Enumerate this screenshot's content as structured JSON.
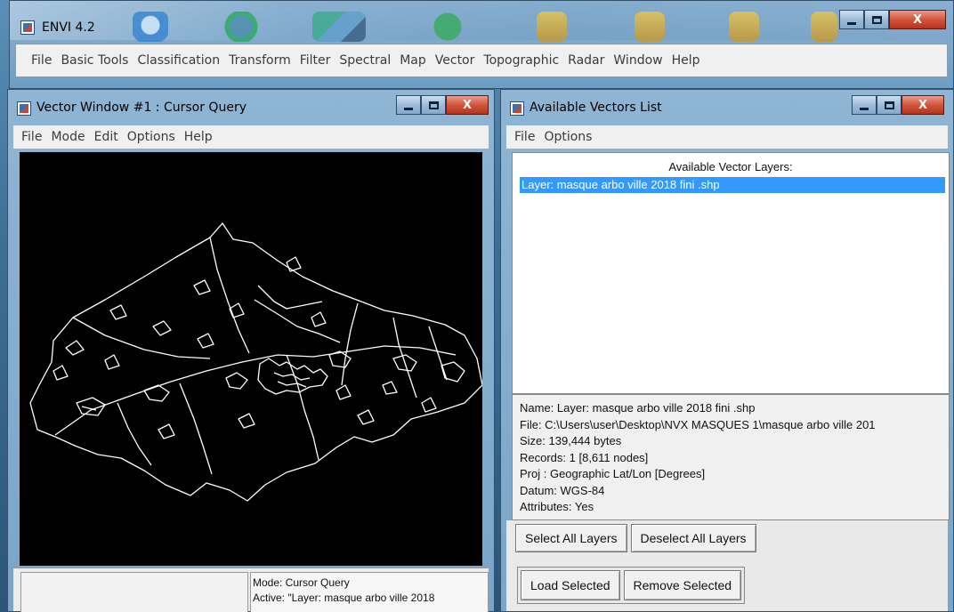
{
  "main_window": {
    "title": "ENVI 4.2",
    "menu": [
      "File",
      "Basic Tools",
      "Classification",
      "Transform",
      "Filter",
      "Spectral",
      "Map",
      "Vector",
      "Topographic",
      "Radar",
      "Window",
      "Help"
    ],
    "controls": {
      "minimize": "_",
      "maximize": "□",
      "close": "X"
    }
  },
  "vector_window": {
    "title": "Vector Window #1 : Cursor Query",
    "menu": [
      "File",
      "Mode",
      "Edit",
      "Options",
      "Help"
    ],
    "status": {
      "mode": "Mode: Cursor Query",
      "active": "Active: \"Layer: masque arbo ville 2018"
    },
    "controls": {
      "minimize": "_",
      "maximize": "□",
      "close": "X"
    }
  },
  "vectors_list": {
    "title": "Available Vectors List",
    "menu": [
      "File",
      "Options"
    ],
    "list_heading": "Available Vector Layers:",
    "layers": [
      "Layer: masque arbo ville 2018 fini .shp"
    ],
    "info": [
      "Name: Layer: masque arbo ville 2018 fini .shp",
      "File: C:\\Users\\user\\Desktop\\NVX MASQUES 1\\masque arbo ville 201",
      "Size: 139,444 bytes",
      "Records: 1 [8,611 nodes]",
      "Proj : Geographic Lat/Lon [Degrees]",
      "Datum: WGS-84",
      "Attributes: Yes"
    ],
    "buttons": {
      "select_all": "Select All Layers",
      "deselect_all": "Deselect All Layers",
      "load_selected": "Load Selected",
      "remove_selected": "Remove Selected"
    },
    "controls": {
      "minimize": "_",
      "maximize": "□",
      "close": "X"
    }
  },
  "colors": {
    "selection": "#3399ff",
    "canvas": "#000000",
    "vector_stroke": "#ffffff",
    "close_button": "#c8432a"
  }
}
